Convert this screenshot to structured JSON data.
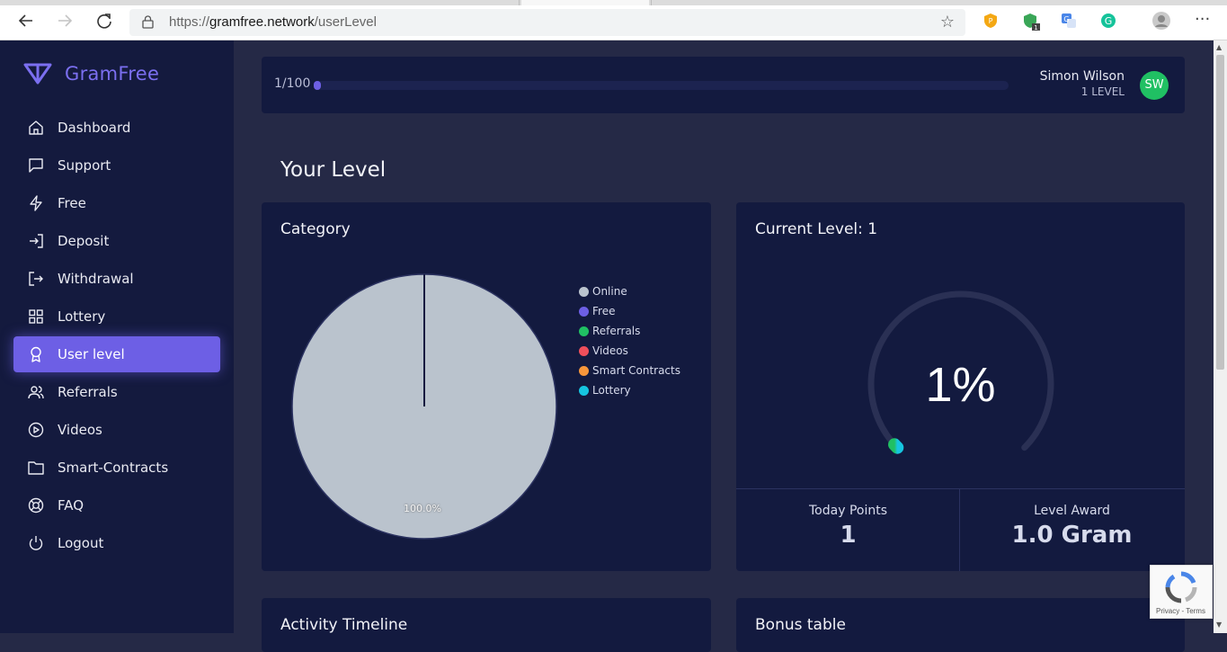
{
  "browser": {
    "url_prefix": "https://",
    "url_host": "gramfree.network",
    "url_path": "/userLevel"
  },
  "sidebar": {
    "brand": "GramFree",
    "items": [
      {
        "label": "Dashboard",
        "icon": "home-icon"
      },
      {
        "label": "Support",
        "icon": "chat-icon"
      },
      {
        "label": "Free",
        "icon": "lightning-icon"
      },
      {
        "label": "Deposit",
        "icon": "login-icon"
      },
      {
        "label": "Withdrawal",
        "icon": "logout-arrow-icon"
      },
      {
        "label": "Lottery",
        "icon": "grid-icon"
      },
      {
        "label": "User level",
        "icon": "award-icon",
        "active": true
      },
      {
        "label": "Referrals",
        "icon": "users-icon"
      },
      {
        "label": "Videos",
        "icon": "play-circle-icon"
      },
      {
        "label": "Smart-Contracts",
        "icon": "folder-icon"
      },
      {
        "label": "FAQ",
        "icon": "lifebuoy-icon"
      },
      {
        "label": "Logout",
        "icon": "power-icon"
      }
    ]
  },
  "topbar": {
    "progress_text": "1/100",
    "progress_fraction": 0.01,
    "user_name": "Simon Wilson",
    "user_level": "1 LEVEL",
    "avatar_initials": "SW"
  },
  "page": {
    "title": "Your Level"
  },
  "category_card": {
    "title": "Category",
    "pie_label": "100.0%",
    "legend": [
      {
        "label": "Online",
        "color": "#bac3cd"
      },
      {
        "label": "Free",
        "color": "#6d5fe5"
      },
      {
        "label": "Referrals",
        "color": "#20c063"
      },
      {
        "label": "Videos",
        "color": "#ef4f5b"
      },
      {
        "label": "Smart Contracts",
        "color": "#f7963b"
      },
      {
        "label": "Lottery",
        "color": "#16c5e0"
      }
    ]
  },
  "level_card": {
    "title": "Current Level: 1",
    "gauge_value": "1%",
    "gauge_fraction": 0.01,
    "today_points_label": "Today Points",
    "today_points_value": "1",
    "level_award_label": "Level Award",
    "level_award_value": "1.0 Gram"
  },
  "bottom_cards": {
    "left_title": "Activity Timeline",
    "right_title": "Bonus table"
  },
  "recaptcha": {
    "text": "Privacy - Terms"
  },
  "colors": {
    "accent": "#6d5fe5",
    "sidebar_bg": "#141a3e",
    "card_bg": "#131a3f",
    "main_bg": "#252946"
  }
}
